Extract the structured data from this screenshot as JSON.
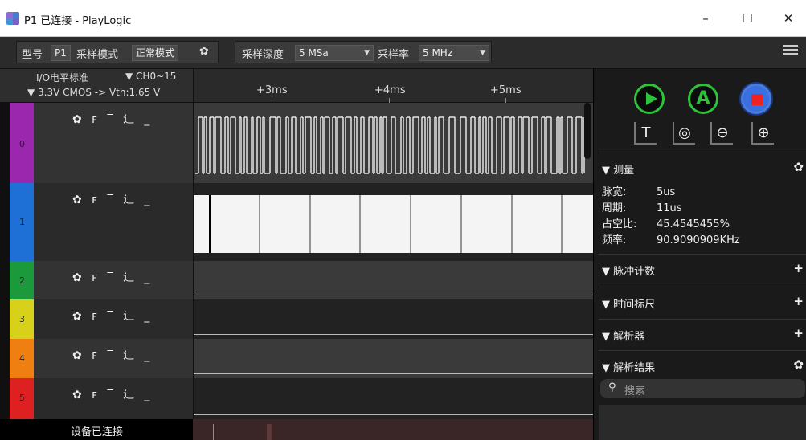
{
  "window": {
    "title": "P1 已连接 - PlayLogic",
    "minimize": "–",
    "maximize": "☐",
    "close": "✕"
  },
  "toolbar": {
    "model_label": "型号",
    "model_value": "P1",
    "mode_label": "采样模式",
    "mode_value": "正常模式",
    "depth_label": "采样深度",
    "depth_value": "5 MSa",
    "rate_label": "采样率",
    "rate_value": "5 MHz"
  },
  "channel_header": {
    "io_standard": "I/O电平标准",
    "channel_range": "▼ CH0~15",
    "voltage": "▼ 3.3V CMOS -> Vth:1.65 V"
  },
  "channels": [
    {
      "id": "0",
      "color": "#9b27af"
    },
    {
      "id": "1",
      "color": "#1e6fd6"
    },
    {
      "id": "2",
      "color": "#1a9a3a"
    },
    {
      "id": "3",
      "color": "#d7d11a"
    },
    {
      "id": "4",
      "color": "#ee7f10"
    },
    {
      "id": "5",
      "color": "#dd2020"
    }
  ],
  "trigger_glyphs": "✿ ꜰ ‾ ⻌ _",
  "time_ticks": [
    "+3ms",
    "+4ms",
    "+5ms"
  ],
  "measure": {
    "title": "▼ 测量",
    "pulse_width_label": "脉宽:",
    "pulse_width_value": "5us",
    "period_label": "周期:",
    "period_value": "11us",
    "duty_label": "占空比:",
    "duty_value": "45.4545455%",
    "freq_label": "频率:",
    "freq_value": "90.9090909KHz"
  },
  "sections": {
    "pulse_count": "▼ 脉冲计数",
    "time_ruler": "▼ 时间标尺",
    "decoder": "▼ 解析器",
    "decode_results": "▼ 解析结果"
  },
  "search": {
    "placeholder": "搜索"
  },
  "status": {
    "text": "设备已连接"
  },
  "colors": {
    "run_green": "#2ec23a",
    "stop_red": "#e22222",
    "stop_blue": "#3a6fe0"
  }
}
